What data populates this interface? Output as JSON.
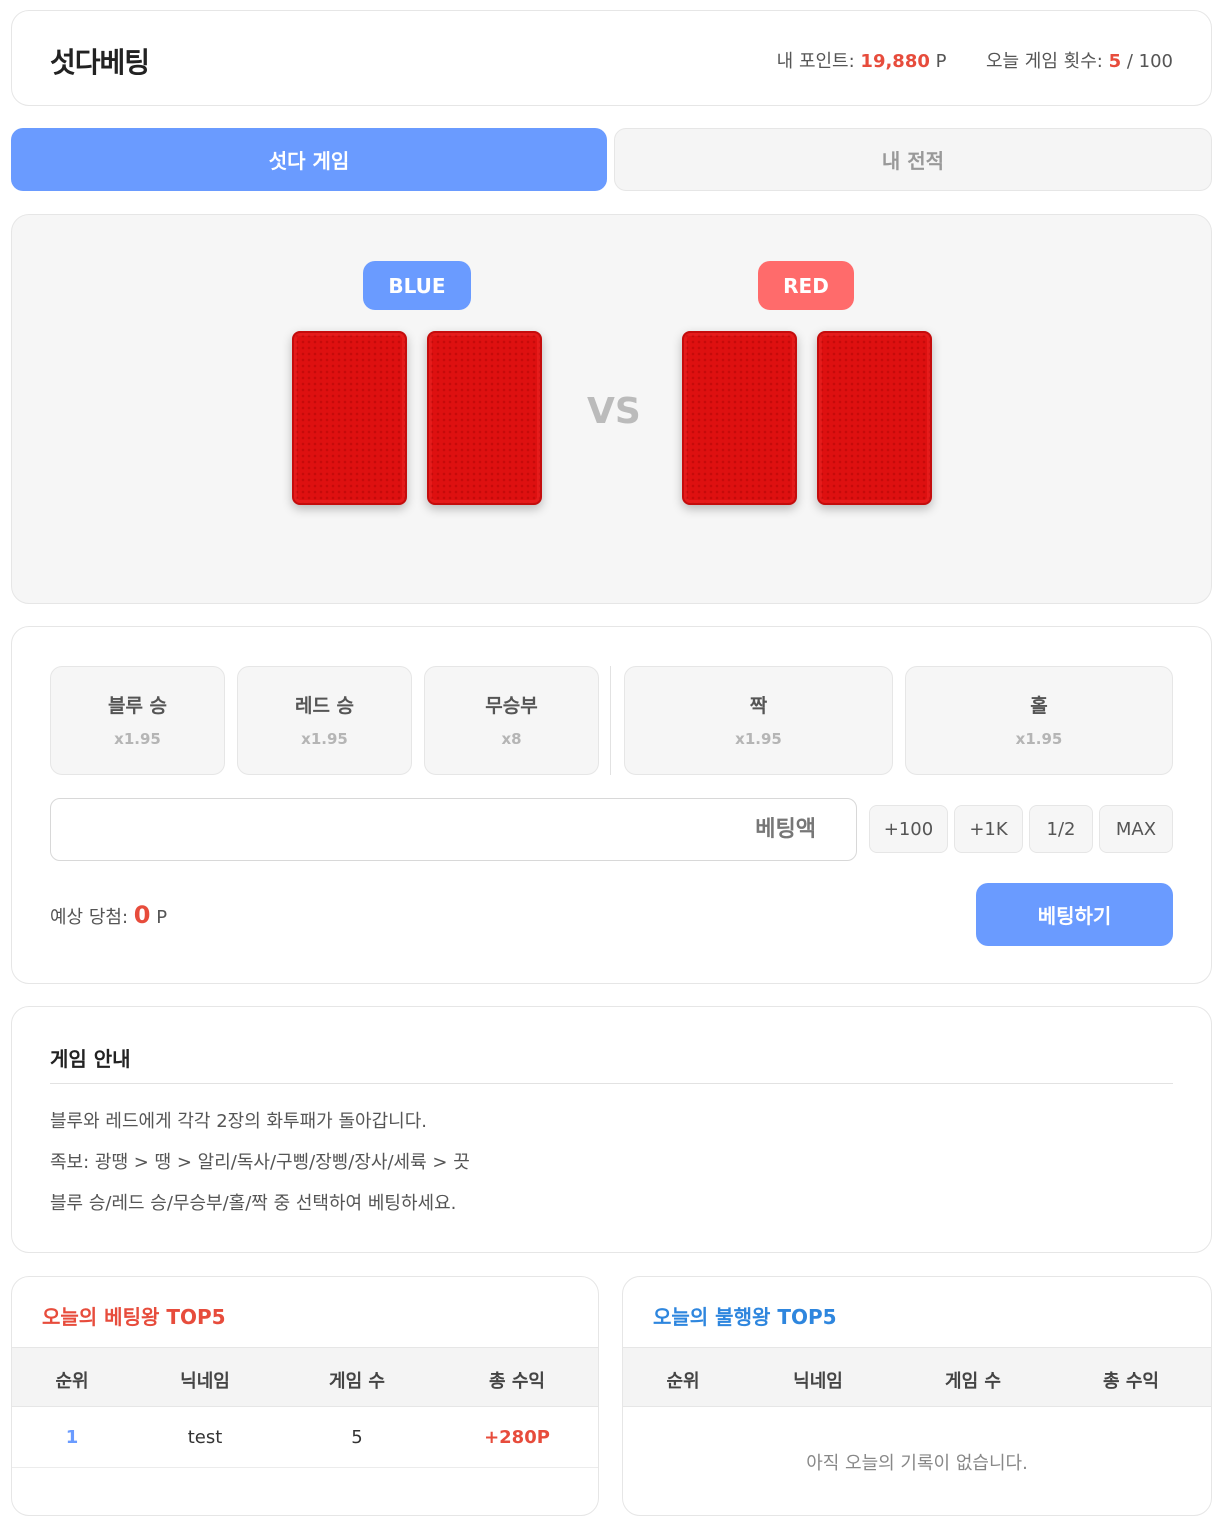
{
  "header": {
    "title": "섯다베팅",
    "points_label": "내 포인트:",
    "points_value": "19,880",
    "points_unit": "P",
    "games_label": "오늘 게임 횟수:",
    "games_value": "5",
    "games_sep": "/",
    "games_max": "100"
  },
  "tabs": [
    {
      "label": "섯다 게임",
      "active": true
    },
    {
      "label": "내 전적",
      "active": false
    }
  ],
  "board": {
    "blue_label": "BLUE",
    "red_label": "RED",
    "vs_label": "VS",
    "card_back_color": "#de1010"
  },
  "bet_options": [
    {
      "label": "블루 승",
      "odds": "x1.95"
    },
    {
      "label": "레드 승",
      "odds": "x1.95"
    },
    {
      "label": "무승부",
      "odds": "x8"
    },
    {
      "label": "짝",
      "odds": "x1.95"
    },
    {
      "label": "홀",
      "odds": "x1.95"
    }
  ],
  "amount": {
    "placeholder": "베팅액",
    "value": ""
  },
  "quick_buttons": [
    "+100",
    "+1K",
    "1/2",
    "MAX"
  ],
  "expected": {
    "label": "예상 당첨:",
    "value": "0",
    "unit": "P"
  },
  "submit_label": "베팅하기",
  "guide": {
    "title": "게임 안내",
    "lines": [
      "블루와 레드에게 각각 2장의 화투패가 돌아갑니다.",
      "족보: 광땡 > 땡 > 알리/독사/구삥/장삥/장사/세륙 > 끗",
      "블루 승/레드 승/무승부/홀/짝 중 선택하여 베팅하세요."
    ]
  },
  "top_winners": {
    "title": "오늘의 베팅왕 TOP5",
    "columns": [
      "순위",
      "닉네임",
      "게임 수",
      "총 수익"
    ],
    "rows": [
      {
        "rank": "1",
        "nickname": "test",
        "games": "5",
        "profit": "+280P"
      }
    ]
  },
  "top_losers": {
    "title": "오늘의 불행왕 TOP5",
    "columns": [
      "순위",
      "닉네임",
      "게임 수",
      "총 수익"
    ],
    "empty_text": "아직 오늘의 기록이 없습니다."
  },
  "colors": {
    "accent_blue": "#6a9bff",
    "accent_red": "#ff6b6b",
    "profit_red": "#e74c3c",
    "loser_title_blue": "#2e86de"
  }
}
